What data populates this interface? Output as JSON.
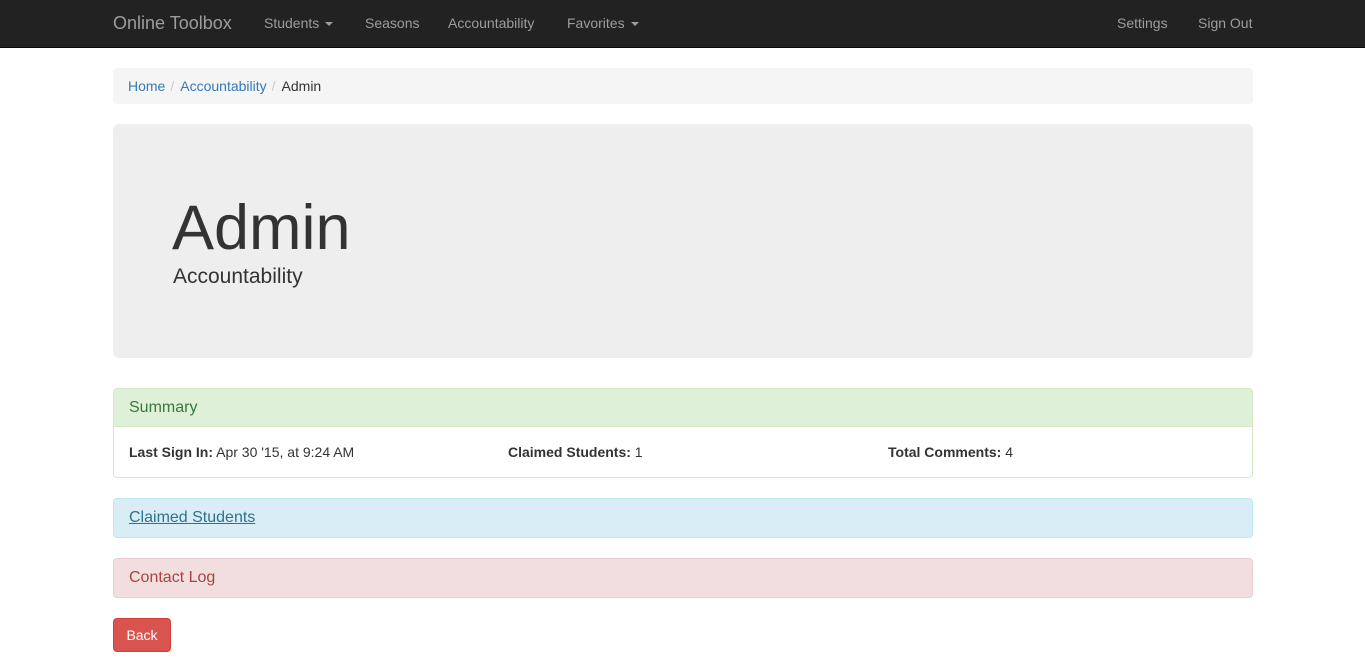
{
  "navbar": {
    "brand": "Online Toolbox",
    "items": [
      {
        "label": "Students",
        "dropdown": true
      },
      {
        "label": "Seasons",
        "dropdown": false
      },
      {
        "label": "Accountability",
        "dropdown": false
      },
      {
        "label": "Favorites",
        "dropdown": true
      }
    ],
    "right_items": [
      {
        "label": "Settings"
      },
      {
        "label": "Sign Out"
      }
    ]
  },
  "breadcrumb": {
    "items": [
      "Home",
      "Accountability"
    ],
    "active": "Admin",
    "separator": "/"
  },
  "jumbotron": {
    "title": "Admin",
    "subtitle": "Accountability"
  },
  "summary": {
    "heading": "Summary",
    "last_sign_in_label": "Last Sign In:",
    "last_sign_in_value": "Apr 30 '15, at 9:24 AM",
    "claimed_label": "Claimed Students:",
    "claimed_value": "1",
    "comments_label": "Total Comments:",
    "comments_value": "4"
  },
  "claimed_panel": {
    "heading": "Claimed Students"
  },
  "contact_panel": {
    "heading": "Contact Log"
  },
  "back_button": {
    "label": "Back"
  },
  "colors": {
    "navbar": "#222222",
    "success": "#dff0d8",
    "info": "#d9edf7",
    "danger": "#f2dede",
    "button_danger": "#d9534f",
    "link": "#337ab7"
  }
}
